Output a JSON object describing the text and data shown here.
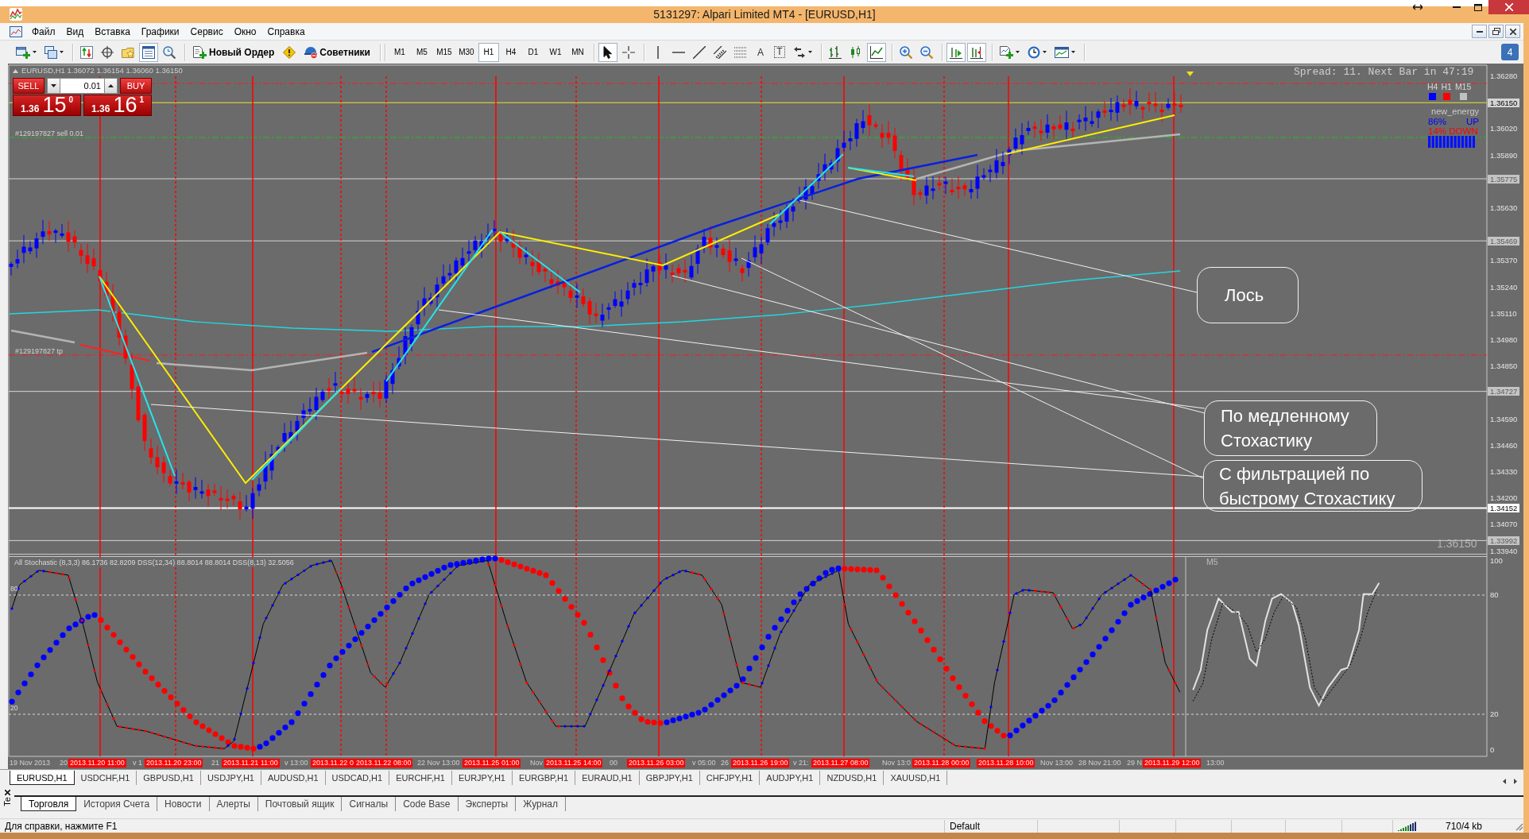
{
  "window": {
    "title": "5131297: Alpari Limited MT4 - [EURUSD,H1]"
  },
  "menu": [
    "Файл",
    "Вид",
    "Вставка",
    "Графики",
    "Сервис",
    "Окно",
    "Справка"
  ],
  "toolbar": {
    "view_buttons": [
      {
        "pressed": false
      },
      {
        "pressed": false
      },
      {
        "pressed": false
      },
      {
        "pressed": true
      },
      {
        "pressed": false
      }
    ],
    "new_order": "Новый Ордер",
    "experts": "Советники",
    "timeframes": [
      {
        "label": "M1",
        "selected": false
      },
      {
        "label": "M5",
        "selected": false
      },
      {
        "label": "M15",
        "selected": false
      },
      {
        "label": "M30",
        "selected": false
      },
      {
        "label": "H1",
        "selected": true
      },
      {
        "label": "H4",
        "selected": false
      },
      {
        "label": "D1",
        "selected": false
      },
      {
        "label": "W1",
        "selected": false
      },
      {
        "label": "MN",
        "selected": false
      }
    ],
    "cursor_modes": [
      {
        "selected": true
      },
      {
        "selected": false
      }
    ],
    "text_tools": [
      "A",
      "T"
    ],
    "chart_types": [
      {
        "selected": false
      },
      {
        "selected": false
      },
      {
        "selected": true
      }
    ],
    "chart_options": [
      {
        "pressed": true
      },
      {
        "pressed": true
      }
    ],
    "messages": "4"
  },
  "chart": {
    "header": "EURUSD,H1 1.36072 1.36154 1.36060 1.36150",
    "trade_panel": {
      "sell": "SELL",
      "buy": "BUY",
      "lot": "0.01",
      "sell_price": {
        "big_figure": "1.36",
        "pips": "15",
        "fraction": "0"
      },
      "buy_price": {
        "big_figure": "1.36",
        "pips": "16",
        "fraction": "1"
      }
    },
    "order_lines": [
      {
        "label": "#129197827 sell 0.01",
        "kind": "entry"
      },
      {
        "label": "#129197827 tp",
        "kind": "take_profit"
      }
    ],
    "info": "Spread: 11. Next Bar in 47:19",
    "trend_signals": [
      {
        "label": "H4",
        "color": "#0000ff"
      },
      {
        "label": "H1",
        "color": "#ff0000"
      },
      {
        "label": "M15",
        "color": "#c0c0c0"
      }
    ],
    "energy": {
      "title": "new_energy",
      "up_share": "86%",
      "up": "UP",
      "down": "14% DOWN"
    },
    "callouts": [
      "Лось",
      "По медленному Стохастику",
      "С фильтрацией по быстрому Стохастику"
    ],
    "last_price": "1.36150",
    "price_axis": {
      "ticks": [
        "1.36280",
        "1.36020",
        "1.35890",
        "1.35630",
        "1.35370",
        "1.35240",
        "1.35110",
        "1.34980",
        "1.34850",
        "1.34590",
        "1.34460",
        "1.34330",
        "1.34200",
        "1.34070",
        "1.33940"
      ],
      "markers": [
        {
          "label": "1.36150",
          "kind": "bid"
        },
        {
          "label": "1.35775",
          "kind": "level"
        },
        {
          "label": "1.35469",
          "kind": "level"
        },
        {
          "label": "1.34727",
          "kind": "level"
        },
        {
          "label": "1.34152",
          "kind": "support"
        },
        {
          "label": "1.33992",
          "kind": "level"
        }
      ]
    },
    "stochastic": {
      "header": "All Stochastic (8,3,3) 86.1736 82.8209 DSS(12,34) 88.8014 88.8014 DSS(8,13) 32.5056",
      "inset_label": "M5",
      "axis": [
        "100",
        "80",
        "20",
        "0"
      ],
      "level_labels": [
        "80",
        "20"
      ]
    },
    "time_axis": {
      "labels": [
        "19 Nov 2013",
        "20",
        "v 1",
        "21",
        "v 13:00",
        "22 Nov 13:00",
        "Nov",
        "00",
        "v 05:00",
        "26",
        "v 21:",
        "Nov 13:0",
        "Nov 13:00",
        "28 Nov 21:00",
        "29 N",
        "13:00"
      ],
      "markers": [
        {
          "label": "2013.11.20 11:00",
          "dashed": false
        },
        {
          "label": "2013.11.20 23:00",
          "dashed": true
        },
        {
          "label": "2013.11.21 11:00",
          "dashed": false
        },
        {
          "label": "2013.11.22 0",
          "dashed": true
        },
        {
          "label": "2013.11.22 08:00",
          "dashed": true
        },
        {
          "label": "2013.11.25 01:00",
          "dashed": false
        },
        {
          "label": "2013.11.25 14:00",
          "dashed": true
        },
        {
          "label": "2013.11.26 03:00",
          "dashed": false
        },
        {
          "label": "2013.11.26 19:00",
          "dashed": true
        },
        {
          "label": "2013.11.27 08:00",
          "dashed": false
        },
        {
          "label": "2013.11.28 00:00",
          "dashed": true
        },
        {
          "label": "2013.11.28 10:00",
          "dashed": false
        },
        {
          "label": "2013.11.29 12:00",
          "dashed": false
        }
      ]
    }
  },
  "symbol_tabs": [
    {
      "label": "EURUSD,H1",
      "selected": true
    },
    {
      "label": "USDCHF,H1",
      "selected": false
    },
    {
      "label": "GBPUSD,H1",
      "selected": false
    },
    {
      "label": "USDJPY,H1",
      "selected": false
    },
    {
      "label": "AUDUSD,H1",
      "selected": false
    },
    {
      "label": "USDCAD,H1",
      "selected": false
    },
    {
      "label": "EURCHF,H1",
      "selected": false
    },
    {
      "label": "EURJPY,H1",
      "selected": false
    },
    {
      "label": "EURGBP,H1",
      "selected": false
    },
    {
      "label": "EURAUD,H1",
      "selected": false
    },
    {
      "label": "GBPJPY,H1",
      "selected": false
    },
    {
      "label": "CHFJPY,H1",
      "selected": false
    },
    {
      "label": "AUDJPY,H1",
      "selected": false
    },
    {
      "label": "NZDUSD,H1",
      "selected": false
    },
    {
      "label": "XAUUSD,H1",
      "selected": false
    }
  ],
  "terminal": {
    "side_label": "Te",
    "tabs": [
      {
        "label": "Торговля",
        "selected": true
      },
      {
        "label": "История Счета",
        "selected": false
      },
      {
        "label": "Новости",
        "selected": false
      },
      {
        "label": "Алерты",
        "selected": false
      },
      {
        "label": "Почтовый ящик",
        "selected": false
      },
      {
        "label": "Сигналы",
        "selected": false
      },
      {
        "label": "Code Base",
        "selected": false
      },
      {
        "label": "Эксперты",
        "selected": false
      },
      {
        "label": "Журнал",
        "selected": false
      }
    ]
  },
  "status_bar": {
    "help": "Для справки, нажмите F1",
    "profile": "Default",
    "traffic": "710/4 kb"
  }
}
